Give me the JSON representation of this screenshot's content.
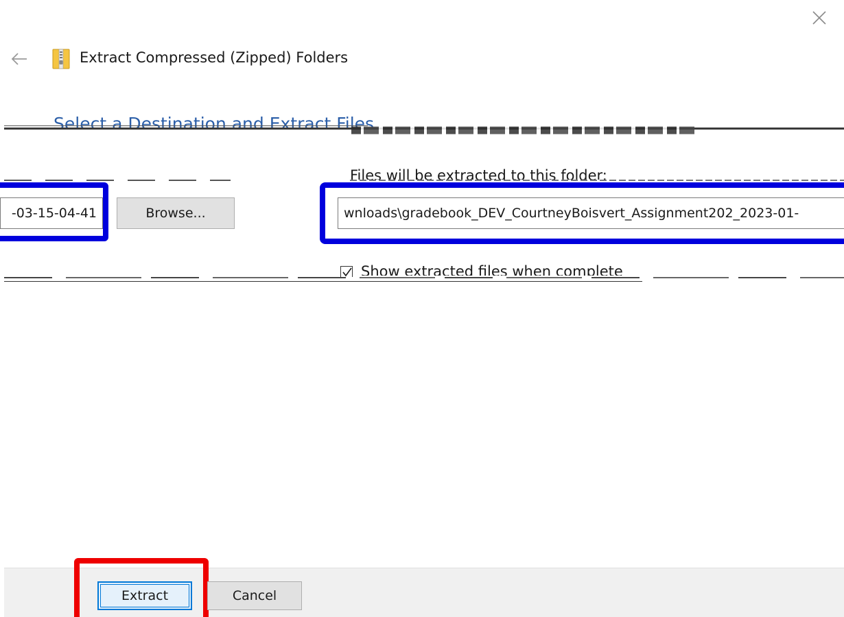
{
  "window": {
    "title": "Extract Compressed (Zipped) Folders",
    "close_icon": "close-icon",
    "back_icon": "back-arrow-icon",
    "app_icon": "zip-folder-icon"
  },
  "main": {
    "heading": "Select a Destination and Extract Files",
    "path_label": "Files will be extracted to this folder:",
    "path_value": "wnloads\\gradebook_DEV_CourtneyBoisvert_Assignment202_2023-01-",
    "left_path_value": "-03-15-04-41",
    "browse_label": "Browse...",
    "show_files_label": "Show extracted files when complete",
    "show_files_checked": true
  },
  "footer": {
    "extract_label": "Extract",
    "cancel_label": "Cancel"
  },
  "colors": {
    "highlight_blue": "#0000dd",
    "highlight_red": "#ee0000",
    "heading_blue": "#2b5ea8",
    "focus_blue": "#0078d7"
  }
}
